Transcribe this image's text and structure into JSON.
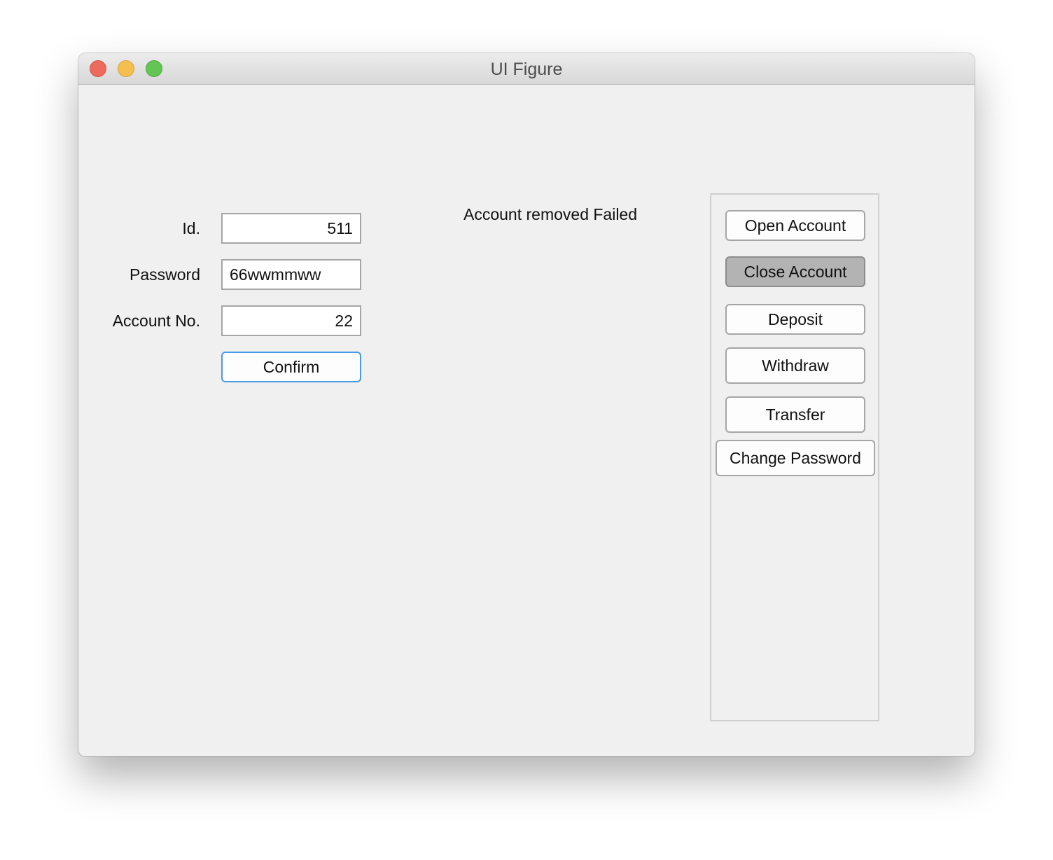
{
  "window": {
    "title": "UI Figure"
  },
  "form": {
    "id_label": "Id.",
    "id_value": "511",
    "password_label": "Password",
    "password_value": "66wwmmww",
    "account_label": "Account No.",
    "account_value": "22",
    "confirm_label": "Confirm"
  },
  "status": {
    "message": "Account removed Failed"
  },
  "actions": {
    "open_account": "Open Account",
    "close_account": "Close Account",
    "deposit": "Deposit",
    "withdraw": "Withdraw",
    "transfer": "Transfer",
    "change_password": "Change Password"
  },
  "colors": {
    "window_bg": "#f0f0f0",
    "confirm_border": "#4a9ae8",
    "pressed_button": "#b3b3b3"
  }
}
